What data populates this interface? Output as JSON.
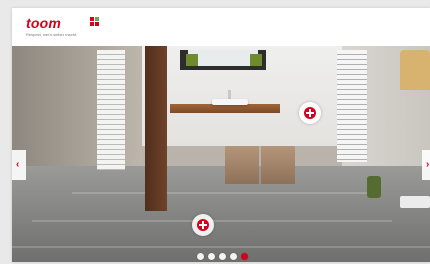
{
  "header": {
    "logo_text": "toom",
    "logo_tagline": "Respekt, wer's selber macht."
  },
  "slider": {
    "prev_label": "‹",
    "next_label": "›",
    "dot_count": 5,
    "active_index": 4
  },
  "hotspots": [
    {
      "name": "hotspot-mirror-shelf"
    },
    {
      "name": "hotspot-floor"
    }
  ],
  "colors": {
    "brand": "#d6001c"
  }
}
